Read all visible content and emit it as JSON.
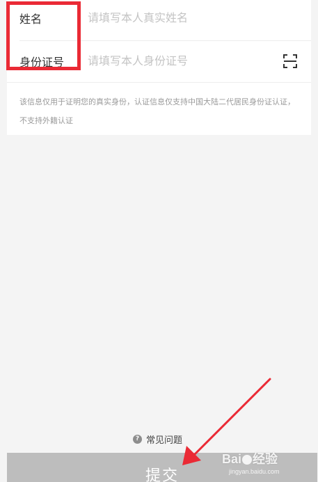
{
  "form": {
    "name_label": "姓名",
    "name_placeholder": "请填写本人真实姓名",
    "id_label": "身份证号",
    "id_placeholder": "请填写本人身份证号",
    "scan_icon": "scan-icon",
    "notice": "该信息仅用于证明您的真实身份，认证信息仅支持中国大陆二代居民身份证认证，不支持外籍认证"
  },
  "faq": {
    "icon": "question-circle-icon",
    "label": "常见问题"
  },
  "submit": {
    "label": "提交"
  },
  "watermark": {
    "brand_left": "Bai",
    "brand_right": "经验",
    "site": "jingyan.baidu.com"
  },
  "colors": {
    "highlight": "#ea2a35",
    "submit_bg": "#bdbdbd",
    "placeholder": "#c4c4c4"
  }
}
